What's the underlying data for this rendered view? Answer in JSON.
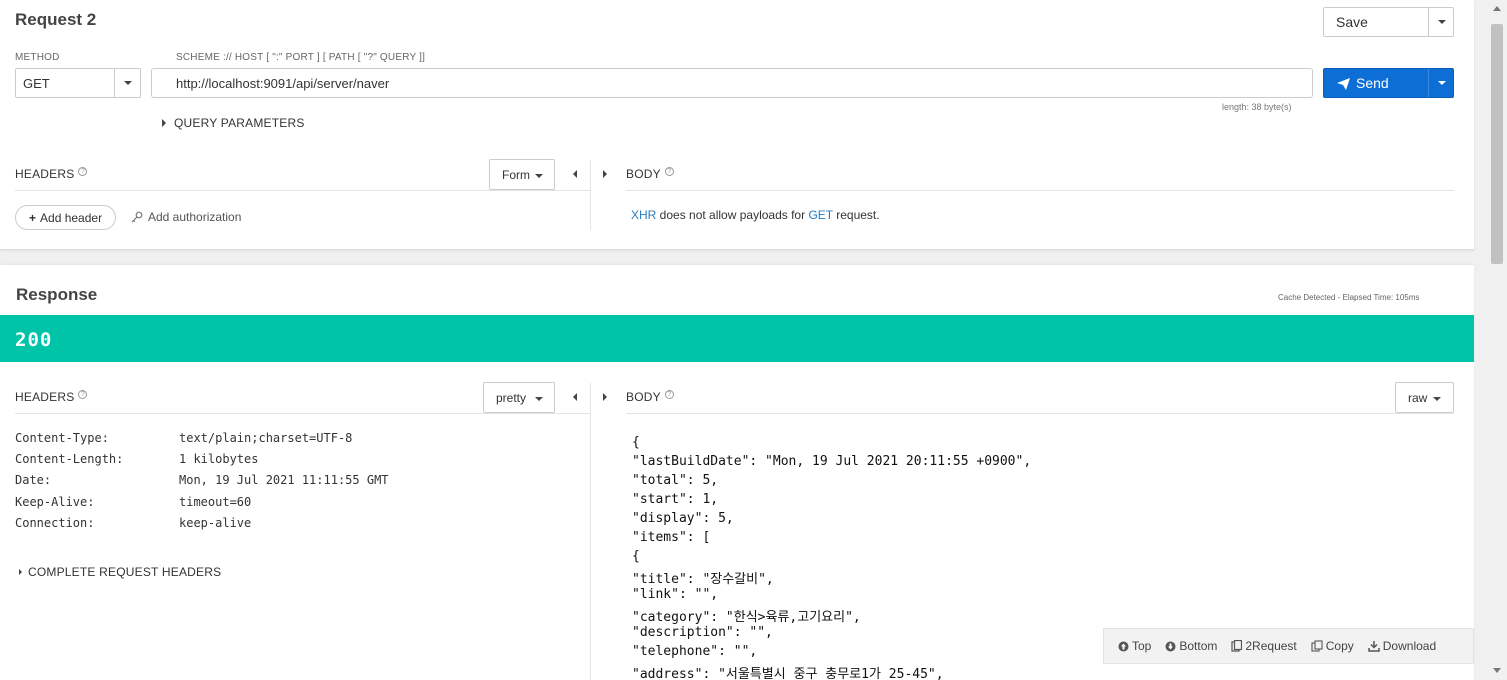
{
  "request": {
    "title": "Request 2",
    "save_label": "Save",
    "method_label": "METHOD",
    "method_value": "GET",
    "url_label": "SCHEME :// HOST [ \":\" PORT ] [ PATH [ \"?\" QUERY ]]",
    "url_value": "http://localhost:9091/api/server/naver",
    "length_text": "length: 38 byte(s)",
    "send_label": "Send",
    "query_params_label": "QUERY PARAMETERS",
    "headers_label": "HEADERS",
    "form_label": "Form",
    "body_label": "BODY",
    "add_header_label": "Add header",
    "add_authorization_label": "Add authorization",
    "body_msg": {
      "xhr": "XHR",
      "mid": " does not allow payloads for ",
      "get": "GET",
      "end": " request."
    }
  },
  "response": {
    "title": "Response",
    "cache_text": "Cache Detected - Elapsed Time: 105ms",
    "status_code": "200",
    "headers_label": "HEADERS",
    "pretty_label": "pretty",
    "body_label": "BODY",
    "raw_label": "raw",
    "headers": [
      {
        "key": "Content-Type:",
        "value": "text/plain;charset=UTF-8"
      },
      {
        "key": "Content-Length:",
        "value": "1 kilobytes"
      },
      {
        "key": "Date:",
        "value": "Mon, 19 Jul 2021 11:11:55 GMT"
      },
      {
        "key": "Keep-Alive:",
        "value": "timeout=60"
      },
      {
        "key": "Connection:",
        "value": "keep-alive"
      }
    ],
    "complete_headers_label": "COMPLETE REQUEST HEADERS",
    "body_lines": [
      "{",
      "\"lastBuildDate\": \"Mon, 19 Jul 2021 20:11:55 +0900\",",
      "\"total\": 5,",
      "\"start\": 1,",
      "\"display\": 5,",
      "\"items\": [",
      "{",
      "\"title\": \"장수갈비\",",
      "\"link\": \"\",",
      "\"category\": \"한식>육류,고기요리\",",
      "\"description\": \"\",",
      "\"telephone\": \"\",",
      "\"address\": \"서울특별시 중구 충무로1가 25-45\","
    ]
  },
  "footer": {
    "top": "Top",
    "bottom": "Bottom",
    "to_request": "2Request",
    "copy": "Copy",
    "download": "Download"
  },
  "colors": {
    "status_ok": "#00c4a7",
    "send_blue": "#0d6fd6",
    "link_blue": "#2b7bc0"
  }
}
